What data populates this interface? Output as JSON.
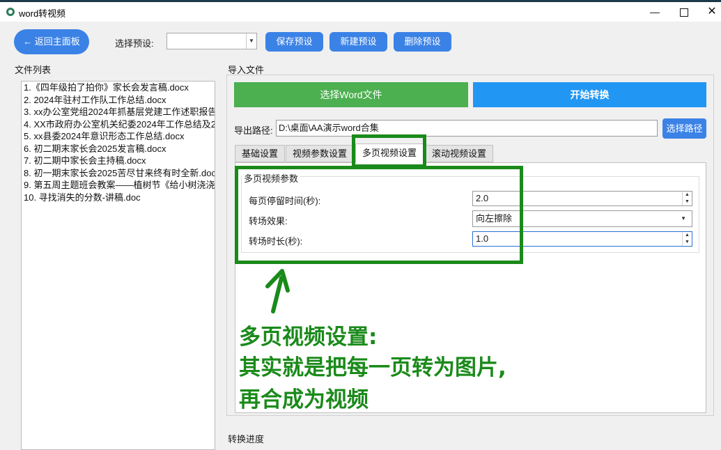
{
  "window": {
    "title": "word转视频"
  },
  "toolbar": {
    "back_label": "← 返回主面板",
    "preset_label": "选择预设:",
    "preset_value": "",
    "save_label": "保存预设",
    "new_label": "新建预设",
    "delete_label": "删除预设"
  },
  "file_list": {
    "label": "文件列表",
    "items": [
      "1.《四年级拍了拍你》家长会发言稿.docx",
      "2. 2024年驻村工作队工作总结.docx",
      "3. xx办公室党组2024年抓基层党建工作述职报告",
      "4. XX市政府办公室机关纪委2024年工作总结及2",
      "5. xx县委2024年意识形态工作总结.docx",
      "6. 初二期末家长会2025发言稿.docx",
      "7. 初二期中家长会主持稿.docx",
      "8. 初一期末家长会2025苦尽甘来终有时全新.doc",
      "9. 第五周主题班会教案——植树节《给小树浇浇",
      "10. 寻找消失的分数-讲稿.doc"
    ]
  },
  "import": {
    "label": "导入文件",
    "select_word_label": "选择Word文件",
    "start_label": "开始转换",
    "output_label": "导出路径:",
    "output_path": "D:\\桌面\\AA演示word合集",
    "choose_path_label": "选择路径"
  },
  "tabs": [
    "基础设置",
    "视频参数设置",
    "多页视频设置",
    "滚动视频设置"
  ],
  "multipage": {
    "group_title": "多页视频参数",
    "dwell_label": "每页停留时间(秒):",
    "dwell_value": "2.0",
    "effect_label": "转场效果:",
    "effect_value": "向左擦除",
    "duration_label": "转场时长(秒):",
    "duration_value": "1.0"
  },
  "annotation": {
    "line1": "多页视频设置:",
    "line2": "其实就是把每一页转为图片,",
    "line3": "再合成为视频",
    "color": "#1a8a1a"
  },
  "progress": {
    "label": "转换进度"
  },
  "colors": {
    "primary": "#3b82e6",
    "green": "#4caf50",
    "blue": "#2196f3"
  }
}
